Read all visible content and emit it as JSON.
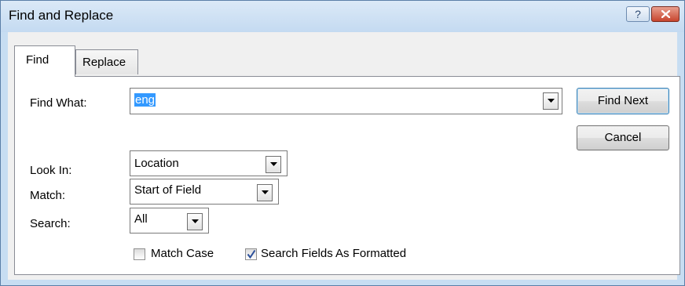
{
  "window": {
    "title": "Find and Replace",
    "help_glyph": "?",
    "icons": {
      "help": "question-mark-icon",
      "close": "close-x-icon"
    }
  },
  "tabs": [
    {
      "label": "Find",
      "selected": true
    },
    {
      "label": "Replace",
      "selected": false
    }
  ],
  "find_what": {
    "label": "Find What:",
    "value": "eng",
    "value_selected": true
  },
  "look_in": {
    "label": "Look In:",
    "value": "Location"
  },
  "match": {
    "label": "Match:",
    "value": "Start of Field"
  },
  "search": {
    "label": "Search:",
    "value": "All"
  },
  "options": {
    "match_case": {
      "label": "Match Case",
      "checked": false
    },
    "search_formatted": {
      "label": "Search Fields As Formatted",
      "checked": true
    }
  },
  "buttons": {
    "find_next": "Find Next",
    "cancel": "Cancel"
  },
  "colors": {
    "title_bar": "#c7ddf2",
    "selection": "#3399ff",
    "close_button": "#c7452e",
    "checkmark": "#2b4f9a"
  }
}
